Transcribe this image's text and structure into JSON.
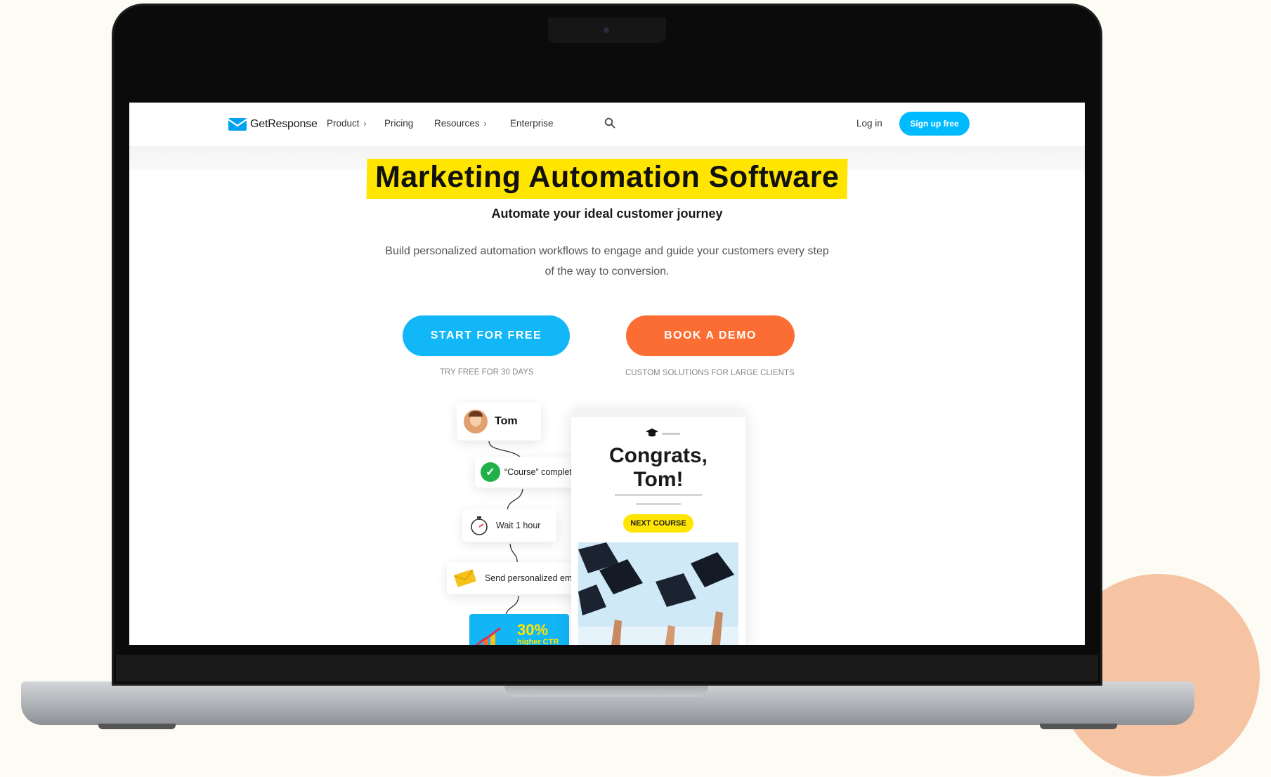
{
  "nav": {
    "logo_text": "GetResponse",
    "product": "Product",
    "pricing": "Pricing",
    "resources": "Resources",
    "enterprise": "Enterprise",
    "chevron": "›",
    "login": "Log in",
    "signup": "Sign up free"
  },
  "hero": {
    "title": "Marketing Automation Software",
    "subtitle": "Automate your ideal customer journey",
    "description": "Build personalized automation workflows to engage and guide your customers every step of the way to conversion."
  },
  "cta": {
    "start_label": "START FOR FREE",
    "start_note": "TRY FREE FOR 30 DAYS",
    "demo_label": "BOOK A DEMO",
    "demo_note": "CUSTOM SOLUTIONS FOR LARGE CLIENTS"
  },
  "workflow": {
    "contact_name": "Tom",
    "course_completed": "“Course” completed",
    "wait": "Wait 1 hour",
    "send_email": "Send personalized email",
    "stat_value": "30%",
    "stat_label": "higher CTR"
  },
  "email_preview": {
    "heading_line1": "Congrats,",
    "heading_line2": "Tom!",
    "button": "NEXT COURSE"
  },
  "colors": {
    "brand_blue": "#00baff",
    "demo_orange": "#fb6d32",
    "highlight_yellow": "#ffe500",
    "check_green": "#22b04b"
  },
  "icons": [
    "envelope-logo-icon",
    "search-icon",
    "check-icon",
    "timer-icon",
    "envelope-icon",
    "graduation-cap-icon",
    "chart-bars-icon"
  ]
}
